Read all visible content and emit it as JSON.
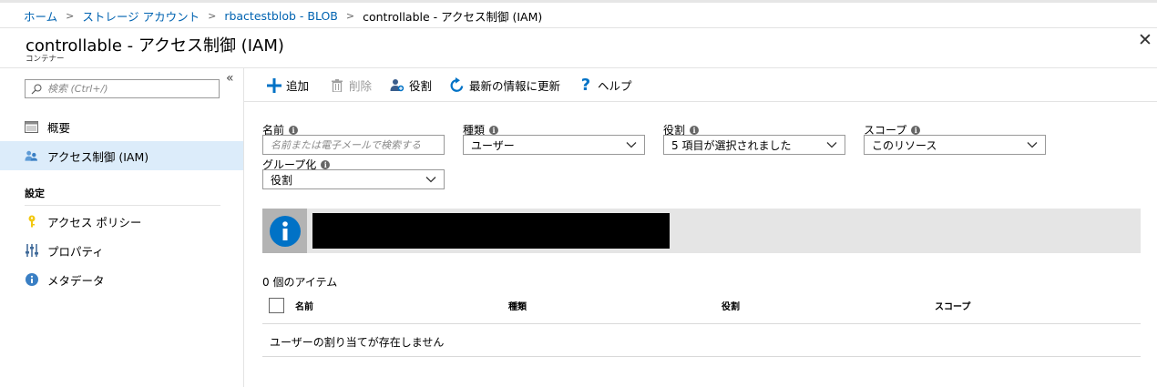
{
  "breadcrumb": {
    "items": [
      "ホーム",
      "ストレージ アカウント",
      "rbactestblob - BLOB"
    ],
    "current": "controllable - アクセス制御 (IAM)"
  },
  "header": {
    "title": "controllable - アクセス制御 (IAM)",
    "subtitle": "コンテナー"
  },
  "sidebar": {
    "search_placeholder": "検索 (Ctrl+/)",
    "items": [
      {
        "label": "概要",
        "icon": "overview-icon"
      },
      {
        "label": "アクセス制御 (IAM)",
        "icon": "iam-users-icon",
        "selected": true
      }
    ],
    "section_title": "設定",
    "settings_items": [
      {
        "label": "アクセス ポリシー",
        "icon": "key-icon"
      },
      {
        "label": "プロパティ",
        "icon": "properties-icon"
      },
      {
        "label": "メタデータ",
        "icon": "info-icon"
      }
    ]
  },
  "toolbar": {
    "add": "追加",
    "delete": "削除",
    "roles": "役割",
    "refresh": "最新の情報に更新",
    "help": "ヘルプ"
  },
  "filters": {
    "name_label": "名前",
    "name_placeholder": "名前または電子メールで検索する",
    "type_label": "種類",
    "type_value": "ユーザー",
    "role_label": "役割",
    "role_value": "5 項目が選択されました",
    "scope_label": "スコープ",
    "scope_value": "このリソース",
    "group_label": "グループ化",
    "group_value": "役割"
  },
  "table": {
    "count_text": "0 個のアイテム",
    "columns": [
      "名前",
      "種類",
      "役割",
      "スコープ"
    ],
    "empty_text": "ユーザーの割り当てが存在しません"
  },
  "colors": {
    "accent": "#0072c6",
    "selected_bg": "#dcecfa",
    "link": "#0063b1"
  }
}
